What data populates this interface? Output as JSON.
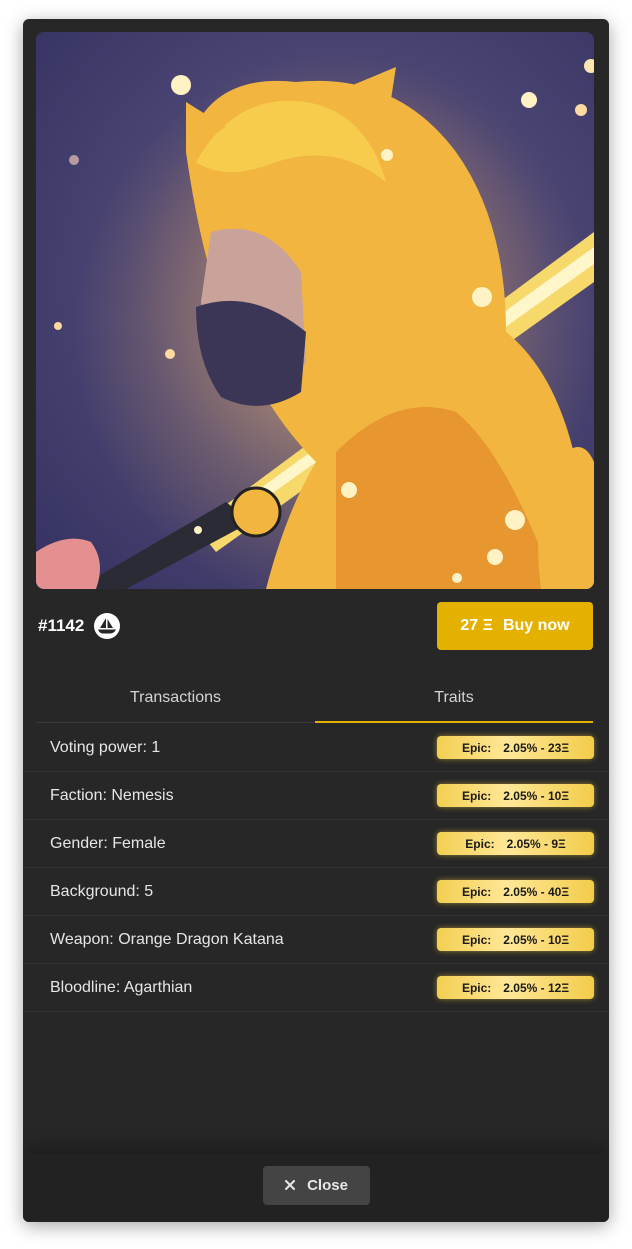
{
  "token": {
    "id": "#1142",
    "marketplace_icon": "opensea-ship-icon"
  },
  "buy": {
    "price": "27 Ξ",
    "label": "Buy now"
  },
  "tabs": [
    {
      "label": "Transactions",
      "active": false
    },
    {
      "label": "Traits",
      "active": true
    }
  ],
  "traits": [
    {
      "label": "Voting power: 1",
      "rarity": "Epic:",
      "value": "2.05% - 23Ξ"
    },
    {
      "label": "Faction: Nemesis",
      "rarity": "Epic:",
      "value": "2.05% - 10Ξ"
    },
    {
      "label": "Gender: Female",
      "rarity": "Epic:",
      "value": "2.05% - 9Ξ"
    },
    {
      "label": "Background: 5",
      "rarity": "Epic:",
      "value": "2.05% - 40Ξ"
    },
    {
      "label": "Weapon: Orange Dragon Katana",
      "rarity": "Epic:",
      "value": "2.05% - 10Ξ"
    },
    {
      "label": "Bloodline: Agarthian",
      "rarity": "Epic:",
      "value": "2.05% - 12Ξ"
    }
  ],
  "footer": {
    "close_label": "Close",
    "close_icon": "close-icon"
  },
  "colors": {
    "accent": "#e5b100",
    "background": "#272727",
    "badge": "#f3cf52"
  }
}
